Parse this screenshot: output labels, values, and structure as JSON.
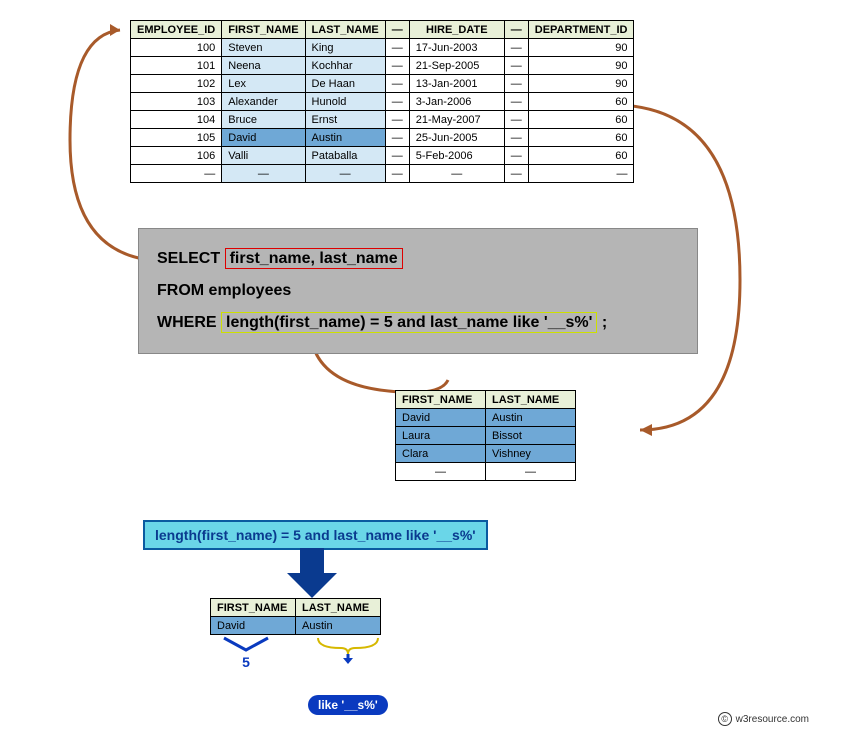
{
  "employees_table": {
    "headers": {
      "emp": "EMPLOYEE_ID",
      "fn": "FIRST_NAME",
      "ln": "LAST_NAME",
      "gap": "—",
      "hire": "HIRE_DATE",
      "dept": "DEPARTMENT_ID"
    },
    "rows": [
      {
        "emp": "100",
        "fn": "Steven",
        "ln": "King",
        "hire": "17-Jun-2003",
        "dept": "90"
      },
      {
        "emp": "101",
        "fn": "Neena",
        "ln": "Kochhar",
        "hire": "21-Sep-2005",
        "dept": "90"
      },
      {
        "emp": "102",
        "fn": "Lex",
        "ln": "De Haan",
        "hire": "13-Jan-2001",
        "dept": "90"
      },
      {
        "emp": "103",
        "fn": "Alexander",
        "ln": "Hunold",
        "hire": "3-Jan-2006",
        "dept": "60"
      },
      {
        "emp": "104",
        "fn": "Bruce",
        "ln": "Ernst",
        "hire": "21-May-2007",
        "dept": "60"
      },
      {
        "emp": "105",
        "fn": "David",
        "ln": "Austin",
        "hire": "25-Jun-2005",
        "dept": "60"
      },
      {
        "emp": "106",
        "fn": "Valli",
        "ln": "Pataballa",
        "hire": "5-Feb-2006",
        "dept": "60"
      }
    ],
    "highlight_index": 5,
    "ellipsis": "—"
  },
  "sql": {
    "select_kw": "SELECT",
    "select_cols": "first_name, last_name",
    "from_line": "FROM employees",
    "where_kw": "WHERE",
    "where_clause": "length(first_name) = 5 and last_name like '__s%'",
    "semicolon": ";"
  },
  "result_table": {
    "headers": {
      "fn": "FIRST_NAME",
      "ln": "LAST_NAME"
    },
    "rows": [
      {
        "fn": "David",
        "ln": "Austin"
      },
      {
        "fn": "Laura",
        "ln": "Bissot"
      },
      {
        "fn": "Clara",
        "ln": "Vishney"
      }
    ],
    "ellipsis": "—"
  },
  "filter_expr": "length(first_name) = 5 and last_name like '__s%'",
  "single_row": {
    "headers": {
      "fn": "FIRST_NAME",
      "ln": "LAST_NAME"
    },
    "row": {
      "fn": "David",
      "ln": "Austin"
    }
  },
  "annotations": {
    "length_label": "5",
    "like_label": "like '__s%'"
  },
  "copyright": "w3resource.com"
}
